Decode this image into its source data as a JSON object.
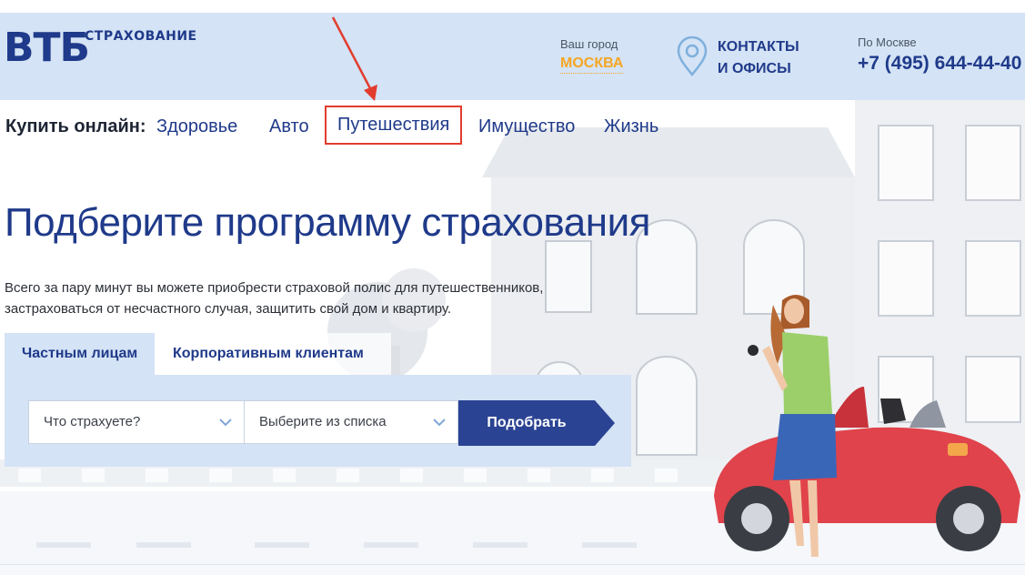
{
  "header": {
    "logo_main": "ВТБ",
    "logo_sub": "СТРАХОВАНИЕ",
    "city_label": "Ваш город",
    "city_value": "МОСКВА",
    "contacts_line1": "КОНТАКТЫ",
    "contacts_line2": "И ОФИСЫ",
    "phone_label": "По Москве",
    "phone": "+7 (495) 644-44-40"
  },
  "nav": {
    "label": "Купить онлайн:",
    "items": [
      {
        "label": "Здоровье"
      },
      {
        "label": "Авто"
      },
      {
        "label": "Путешествия"
      },
      {
        "label": "Имущество"
      },
      {
        "label": "Жизнь"
      }
    ]
  },
  "hero": {
    "title": "Подберите программу страхования",
    "text_line1": "Всего за пару минут вы можете приобрести страховой полис для путешественников,",
    "text_line2": "застраховаться от несчастного случая, защитить свой дом и квартиру."
  },
  "tabs": [
    {
      "label": "Частным лицам",
      "active": true
    },
    {
      "label": "Корпоративным клиентам",
      "active": false
    }
  ],
  "form": {
    "select1": "Что страхуете?",
    "select2": "Выберите из списка",
    "submit_label": "Подобрать"
  },
  "colors": {
    "brand_blue": "#1f3a8a",
    "header_bg": "#d4e3f5",
    "accent_orange": "#f5a623",
    "highlight_red": "#e23c2e"
  }
}
